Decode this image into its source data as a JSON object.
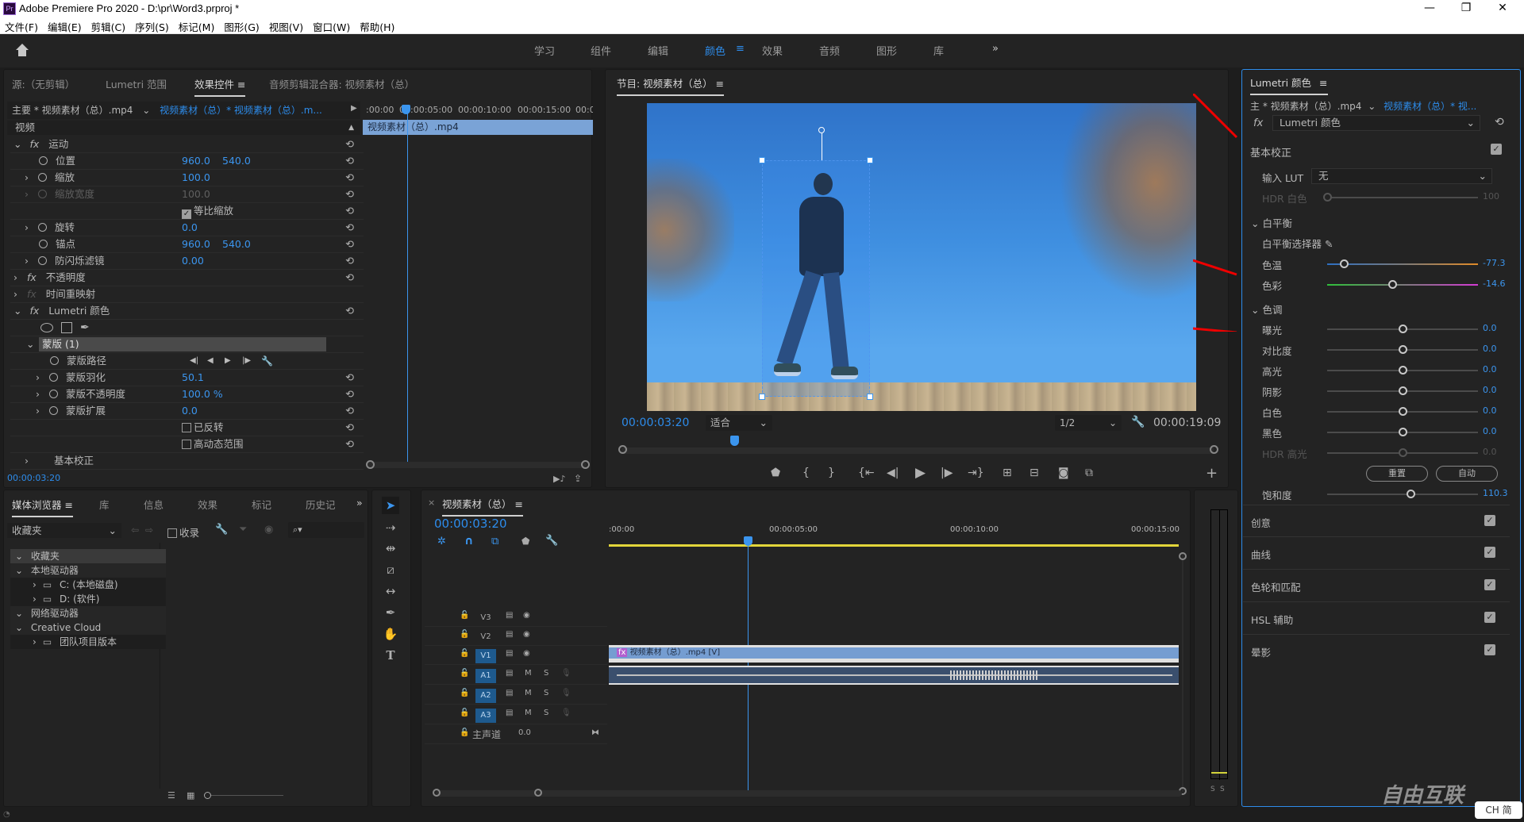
{
  "app": {
    "logo": "Pr",
    "title": "Adobe Premiere Pro 2020 - D:\\pr\\Word3.prproj *",
    "window_controls": {
      "minimize": "—",
      "maximize": "❐",
      "close": "✕"
    }
  },
  "menu": [
    "文件(F)",
    "编辑(E)",
    "剪辑(C)",
    "序列(S)",
    "标记(M)",
    "图形(G)",
    "视图(V)",
    "窗口(W)",
    "帮助(H)"
  ],
  "workspaces": {
    "tabs": [
      "学习",
      "组件",
      "编辑",
      "颜色",
      "效果",
      "音频",
      "图形",
      "库"
    ],
    "active": "颜色",
    "menu_icon": "≡",
    "overflow": "»"
  },
  "effect_controls_panel": {
    "tabs": [
      "源:（无剪辑）",
      "Lumetri 范围",
      "效果控件",
      "音频剪辑混合器: 视频素材（总）"
    ],
    "active_tab": "效果控件",
    "tab_menu": "≡",
    "master_clip": "主要 * 视频素材（总）.mp4",
    "sequence_clip": "视频素材（总）* 视频素材（总）.m...",
    "timeline_ruler": [
      ":00:00",
      "00:00:05:00",
      "00:00:10:00",
      "00:00:15:00",
      "00:0"
    ],
    "clip_bar_label": "视频素材（总）.mp4",
    "section_video": "视频",
    "rows": {
      "motion": "运动",
      "position": {
        "label": "位置",
        "x": "960.0",
        "y": "540.0"
      },
      "scale": {
        "label": "缩放",
        "value": "100.0"
      },
      "scale_width": {
        "label": "缩放宽度",
        "value": "100.0"
      },
      "uniform_scale": {
        "label": "等比缩放",
        "checked": true
      },
      "rotation": {
        "label": "旋转",
        "value": "0.0"
      },
      "anchor": {
        "label": "锚点",
        "x": "960.0",
        "y": "540.0"
      },
      "anti_flicker": {
        "label": "防闪烁滤镜",
        "value": "0.00"
      },
      "opacity": "不透明度",
      "time_remap": "时间重映射",
      "lumetri": "Lumetri 颜色",
      "mask": "蒙版 (1)",
      "mask_path": "蒙版路径",
      "mask_feather": {
        "label": "蒙版羽化",
        "value": "50.1"
      },
      "mask_opacity": {
        "label": "蒙版不透明度",
        "value": "100.0 %"
      },
      "mask_expansion": {
        "label": "蒙版扩展",
        "value": "0.0"
      },
      "inverted": {
        "label": "已反转",
        "checked": false
      },
      "hdr": {
        "label": "高动态范围",
        "checked": false
      },
      "basic_correction": "基本校正"
    },
    "current_time": "00:00:03:20"
  },
  "program_monitor": {
    "title": "节目: 视频素材（总）",
    "menu_icon": "≡",
    "current_time": "00:00:03:20",
    "fit": "适合",
    "resolution": "1/2",
    "duration": "00:00:19:09",
    "playhead_fraction": 0.19
  },
  "lumetri_panel": {
    "title": "Lumetri 颜色",
    "menu_icon": "≡",
    "master_clip": "主 * 视频素材（总）.mp4",
    "sequence_clip": "视频素材（总）* 视...",
    "effect": "Lumetri 颜色",
    "basic_correction": {
      "label": "基本校正",
      "enabled": true
    },
    "input_lut": {
      "label": "输入 LUT",
      "value": "无"
    },
    "hdr_white": {
      "label": "HDR 白色",
      "value": "100",
      "fraction": 0.0
    },
    "white_balance": "白平衡",
    "wb_selector": "白平衡选择器",
    "temperature": {
      "label": "色温",
      "value": "-77.3",
      "fraction": 0.11
    },
    "tint": {
      "label": "色彩",
      "value": "-14.6",
      "fraction": 0.43
    },
    "tone": "色调",
    "tone_sliders": [
      {
        "label": "曝光",
        "value": "0.0",
        "fraction": 0.5
      },
      {
        "label": "对比度",
        "value": "0.0",
        "fraction": 0.5
      },
      {
        "label": "高光",
        "value": "0.0",
        "fraction": 0.5
      },
      {
        "label": "阴影",
        "value": "0.0",
        "fraction": 0.5
      },
      {
        "label": "白色",
        "value": "0.0",
        "fraction": 0.5
      },
      {
        "label": "黑色",
        "value": "0.0",
        "fraction": 0.5
      },
      {
        "label": "HDR 高光",
        "value": "0.0",
        "fraction": 0.5
      }
    ],
    "reset_button": "重置",
    "auto_button": "自动",
    "saturation": {
      "label": "饱和度",
      "value": "110.3",
      "fraction": 0.55
    },
    "sections": [
      {
        "label": "创意",
        "enabled": true
      },
      {
        "label": "曲线",
        "enabled": true
      },
      {
        "label": "色轮和匹配",
        "enabled": true
      },
      {
        "label": "HSL 辅助",
        "enabled": true
      },
      {
        "label": "晕影",
        "enabled": true
      }
    ]
  },
  "media_browser": {
    "tabs": [
      "媒体浏览器",
      "库",
      "信息",
      "效果",
      "标记",
      "历史记"
    ],
    "active_tab": "媒体浏览器",
    "tab_menu": "≡",
    "overflow": "»",
    "location": "收藏夹",
    "ingest_label": "收录",
    "search_placeholder": "",
    "tree": [
      {
        "label": "收藏夹",
        "level": 0
      },
      {
        "label": "本地驱动器",
        "level": 0
      },
      {
        "label": "C: (本地磁盘)",
        "level": 1
      },
      {
        "label": "D: (软件)",
        "level": 1
      },
      {
        "label": "网络驱动器",
        "level": 0
      },
      {
        "label": "Creative Cloud",
        "level": 0
      },
      {
        "label": "团队项目版本",
        "level": 1
      }
    ]
  },
  "timeline": {
    "sequence_name": "视频素材（总）",
    "close": "×",
    "menu_icon": "≡",
    "current_time": "00:00:03:20",
    "ruler": [
      ":00:00",
      "00:00:05:00",
      "00:00:10:00",
      "00:00:15:00"
    ],
    "video_tracks": [
      "V3",
      "V2",
      "V1"
    ],
    "audio_tracks": [
      "A1",
      "A2",
      "A3"
    ],
    "mute": "M",
    "solo": "S",
    "master": {
      "label": "主声道",
      "value": "0.0"
    },
    "video_clip": "视频素材（总）.mp4 [V]",
    "fx_badge": "fx"
  },
  "audio_meter": {
    "solo_labels": [
      "S",
      "S"
    ]
  },
  "watermark": {
    "text": "自由互联",
    "ime": "CH 简"
  }
}
